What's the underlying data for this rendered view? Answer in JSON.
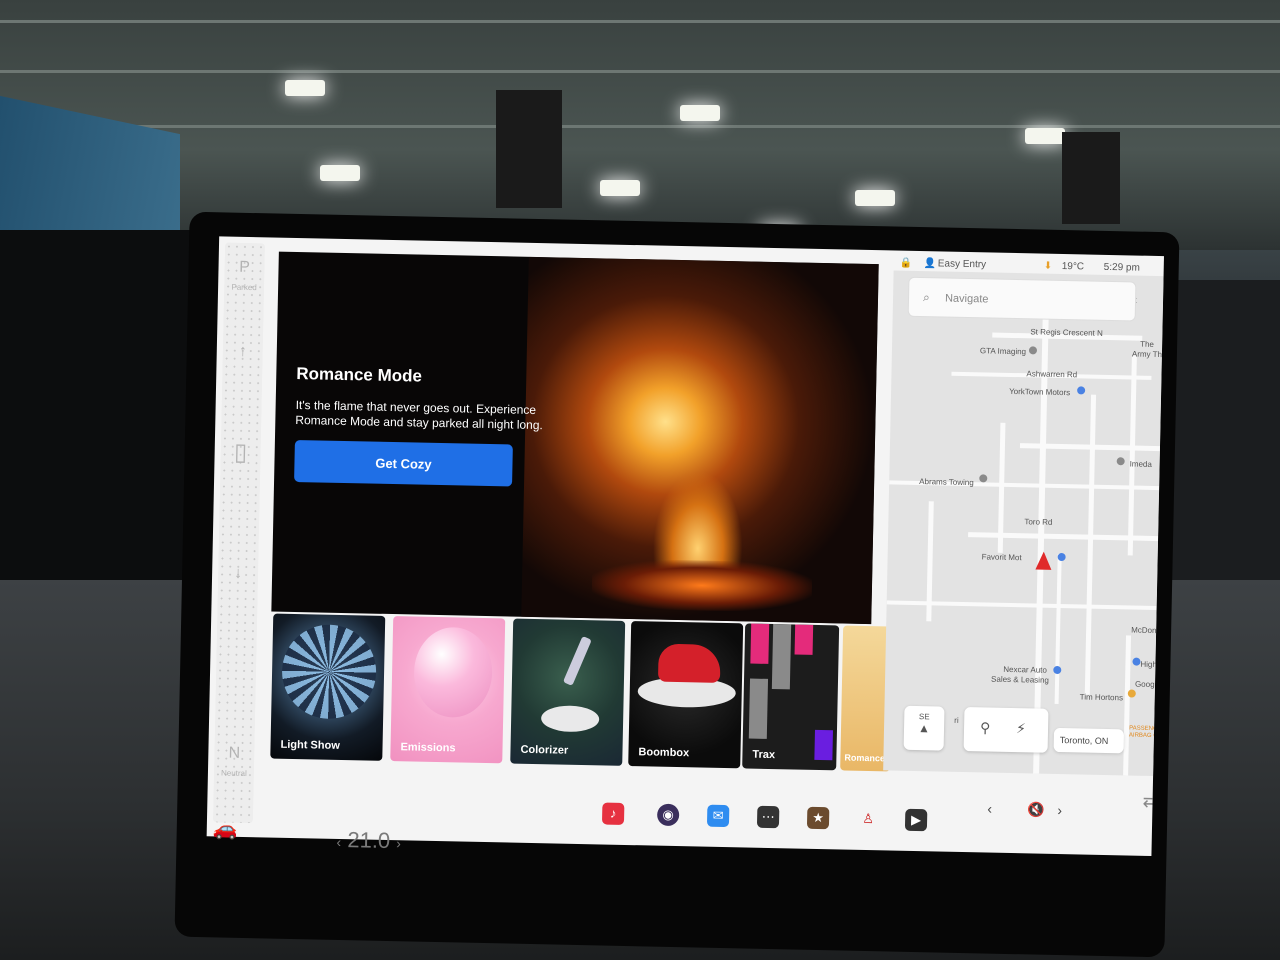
{
  "gear": {
    "park": "P",
    "parked": "Parked",
    "neutral_letter": "N",
    "neutral": "Neutral"
  },
  "hero": {
    "title": "Romance Mode",
    "description": "It's the flame that never goes out. Experience Romance Mode and stay parked all night long.",
    "button": "Get Cozy"
  },
  "tiles": [
    "Light Show",
    "Emissions",
    "Colorizer",
    "Boombox",
    "Trax",
    "Romance"
  ],
  "status": {
    "profile": "Easy Entry",
    "temperature": "19°C",
    "time": "5:29 pm"
  },
  "search": {
    "placeholder": "Navigate"
  },
  "map": {
    "labels": [
      "St Regis Crescent N",
      "GTA Imaging",
      "Ashwarren Rd",
      "YorkTown Motors",
      "The",
      "Army Th",
      "Imeda",
      "Abrams Towing",
      "Toro Rd",
      "Favorit Mot",
      "McDon",
      "High",
      "Nexcar Auto",
      "Sales & Leasing",
      "Tim Hortons",
      "Google",
      "ri",
      "St"
    ],
    "compass": "SE",
    "location": "Toronto, ON",
    "airbag": "PASSENGER AIRBAG OFF"
  },
  "climate": {
    "temperature": "21.0"
  },
  "icons": {
    "music": "music-note-icon",
    "camera": "camera-icon",
    "messages": "messages-icon",
    "more": "more-dots-icon",
    "toybox": "toybox-icon",
    "joystick": "joystick-icon",
    "theater": "theater-icon"
  }
}
